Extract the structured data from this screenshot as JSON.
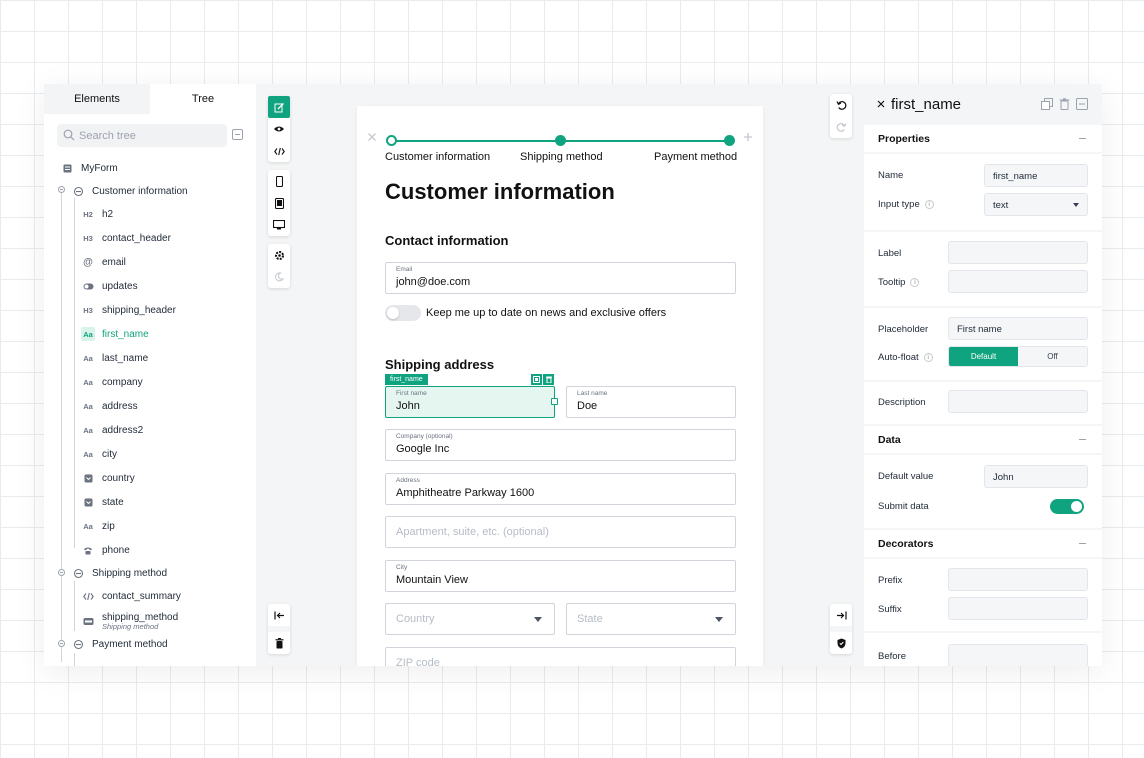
{
  "colors": {
    "accent": "#10a37f",
    "accent_light": "#e4f6ef",
    "panel_bg": "#f4f5f6"
  },
  "left_panel": {
    "tabs": [
      "Elements",
      "Tree"
    ],
    "search_placeholder": "Search tree",
    "tree": {
      "root": "MyForm",
      "groups": [
        {
          "label": "Customer information",
          "items": [
            {
              "icon": "H2",
              "label": "h2"
            },
            {
              "icon": "H3",
              "label": "contact_header"
            },
            {
              "icon": "@",
              "label": "email"
            },
            {
              "icon": "toggle-icon",
              "label": "updates"
            },
            {
              "icon": "H3",
              "label": "shipping_header"
            },
            {
              "icon": "Aa",
              "label": "first_name"
            },
            {
              "icon": "Aa",
              "label": "last_name"
            },
            {
              "icon": "Aa",
              "label": "company"
            },
            {
              "icon": "Aa",
              "label": "address"
            },
            {
              "icon": "Aa",
              "label": "address2"
            },
            {
              "icon": "Aa",
              "label": "city"
            },
            {
              "icon": "select-icon",
              "label": "country"
            },
            {
              "icon": "select-icon",
              "label": "state"
            },
            {
              "icon": "Aa",
              "label": "zip"
            },
            {
              "icon": "phone-icon",
              "label": "phone"
            }
          ]
        },
        {
          "label": "Shipping method",
          "items": [
            {
              "icon": "code-icon",
              "label": "contact_summary"
            },
            {
              "icon": "radio-group-icon",
              "label": "shipping_method",
              "sublabel": "Shipping method"
            }
          ]
        },
        {
          "label": "Payment method",
          "items": []
        }
      ]
    }
  },
  "form": {
    "steps": [
      "Customer information",
      "Shipping method",
      "Payment method"
    ],
    "title": "Customer information",
    "contact_header": "Contact information",
    "email": {
      "label": "Email",
      "value": "john@doe.com"
    },
    "updates_label": "Keep me up to date on news and exclusive offers",
    "shipping_header": "Shipping address",
    "selected_tag": "first_name",
    "first_name": {
      "label": "First name",
      "value": "John"
    },
    "last_name": {
      "label": "Last name",
      "value": "Doe"
    },
    "company": {
      "label": "Company (optional)",
      "value": "Google Inc"
    },
    "address": {
      "label": "Address",
      "value": "Amphitheatre Parkway 1600"
    },
    "address2": {
      "placeholder": "Apartment, suite, etc. (optional)"
    },
    "city": {
      "label": "City",
      "value": "Mountain View"
    },
    "country": {
      "placeholder": "Country"
    },
    "state": {
      "placeholder": "State"
    },
    "zip": {
      "placeholder": "ZIP code"
    }
  },
  "right_panel": {
    "title": "first_name",
    "sections": {
      "properties": "Properties",
      "data": "Data",
      "decorators": "Decorators"
    },
    "props": {
      "name_label": "Name",
      "name_value": "first_name",
      "input_type_label": "Input type",
      "input_type_value": "text",
      "label_label": "Label",
      "tooltip_label": "Tooltip",
      "placeholder_label": "Placeholder",
      "placeholder_value": "First name",
      "autofloat_label": "Auto-float",
      "autofloat_options": [
        "Default",
        "Off"
      ],
      "description_label": "Description",
      "default_value_label": "Default value",
      "default_value": "John",
      "submit_data_label": "Submit data",
      "prefix_label": "Prefix",
      "suffix_label": "Suffix",
      "before_label": "Before"
    }
  }
}
